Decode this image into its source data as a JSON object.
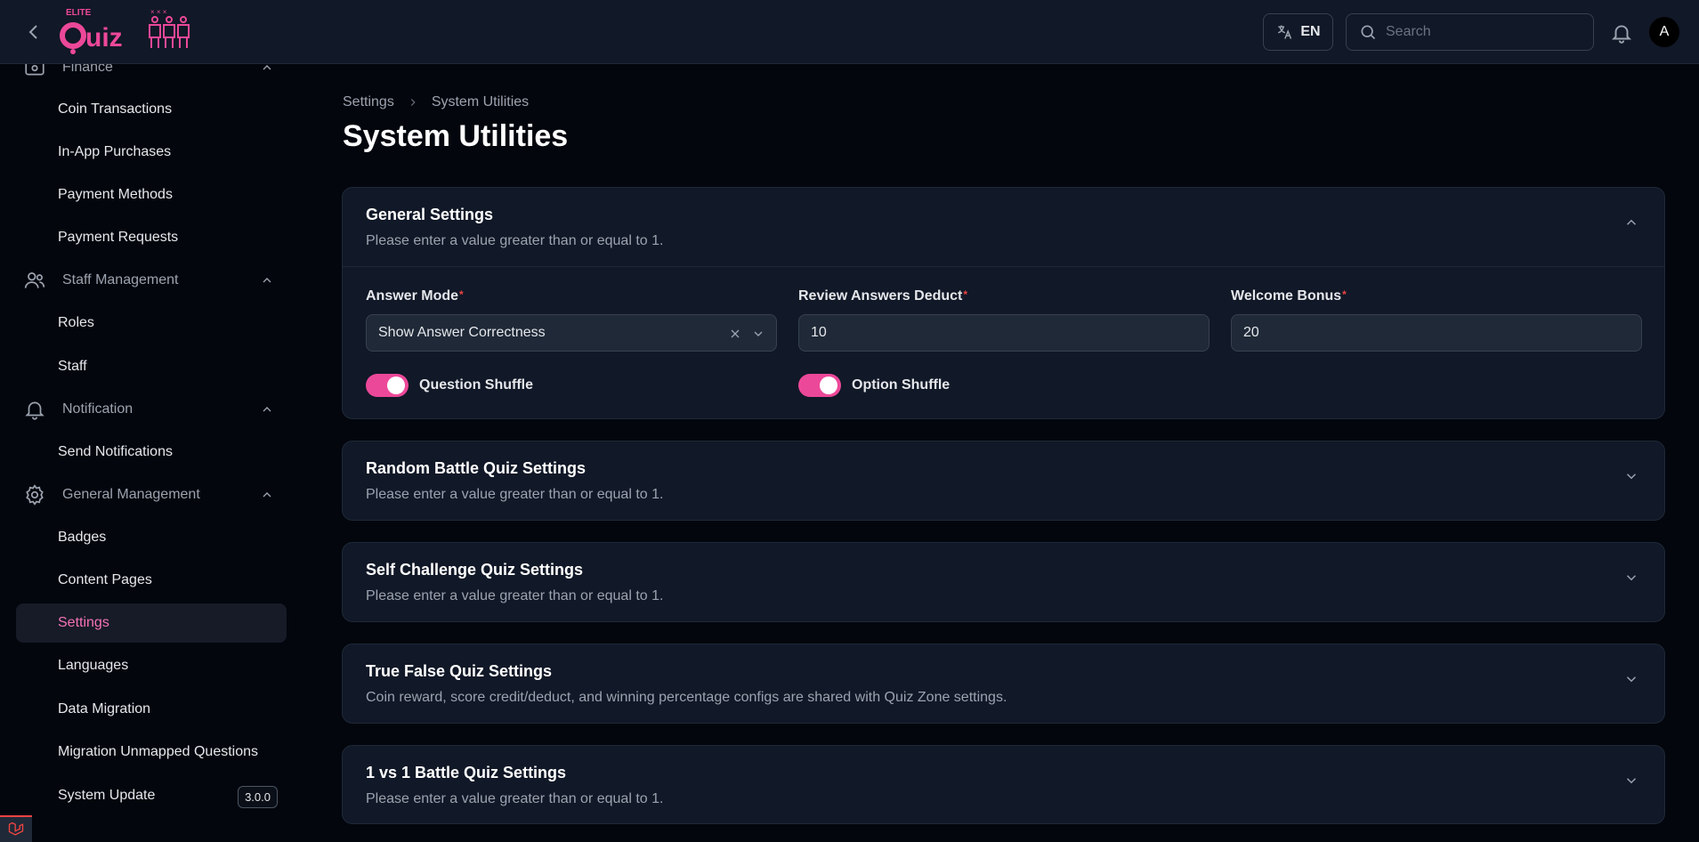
{
  "topbar": {
    "logo_text_top": "ELITE",
    "logo_text_main": "Quiz",
    "language": "EN",
    "search_placeholder": "Search",
    "avatar_initial": "A"
  },
  "sidebar": {
    "groups": [
      {
        "label": "Finance",
        "icon": "finance-icon"
      },
      {
        "label": "Staff Management",
        "icon": "users-icon"
      },
      {
        "label": "Notification",
        "icon": "bell-icon"
      },
      {
        "label": "General Management",
        "icon": "gear-icon"
      }
    ],
    "items": [
      {
        "label": "Coin Transactions"
      },
      {
        "label": "In-App Purchases"
      },
      {
        "label": "Payment Methods"
      },
      {
        "label": "Payment Requests"
      },
      {
        "label": "Roles"
      },
      {
        "label": "Staff"
      },
      {
        "label": "Send Notifications"
      },
      {
        "label": "Badges"
      },
      {
        "label": "Content Pages"
      },
      {
        "label": "Settings",
        "active": true
      },
      {
        "label": "Languages"
      },
      {
        "label": "Data Migration"
      },
      {
        "label": "Migration Unmapped Questions"
      },
      {
        "label": "System Update",
        "badge": "3.0.0"
      }
    ]
  },
  "breadcrumb": {
    "parent": "Settings",
    "current": "System Utilities"
  },
  "page_title": "System Utilities",
  "sections": [
    {
      "title": "General Settings",
      "description": "Please enter a value greater than or equal to 1.",
      "expanded": true,
      "fields": {
        "answer_mode": {
          "label": "Answer Mode",
          "value": "Show Answer Correctness"
        },
        "review_deduct": {
          "label": "Review Answers Deduct",
          "value": "10"
        },
        "welcome_bonus": {
          "label": "Welcome Bonus",
          "value": "20"
        },
        "required_mark": "*"
      },
      "toggles": [
        {
          "label": "Question Shuffle",
          "on": true
        },
        {
          "label": "Option Shuffle",
          "on": true
        }
      ]
    },
    {
      "title": "Random Battle Quiz Settings",
      "description": "Please enter a value greater than or equal to 1."
    },
    {
      "title": "Self Challenge Quiz Settings",
      "description": "Please enter a value greater than or equal to 1."
    },
    {
      "title": "True False Quiz Settings",
      "description": "Coin reward, score credit/deduct, and winning percentage configs are shared with Quiz Zone settings."
    },
    {
      "title": "1 vs 1 Battle Quiz Settings",
      "description": "Please enter a value greater than or equal to 1."
    }
  ],
  "colors": {
    "accent": "#ec4899",
    "background": "#03060d",
    "card": "#111827"
  }
}
